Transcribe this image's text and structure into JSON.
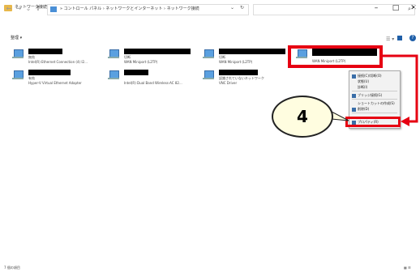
{
  "window": {
    "title": "ネットワーク接続",
    "controls": {
      "minimize": "–",
      "maximize": "□",
      "close": "✕"
    }
  },
  "address_bar": {
    "nav": {
      "back": "←",
      "forward": "→",
      "recent": "⌄",
      "up": "↑"
    },
    "breadcrumb": "» コントロール パネル  ›  ネットワークとインターネット  ›  ネットワーク接続",
    "dropdown": "⌄",
    "refresh": "↻",
    "search_icon": "⌕"
  },
  "toolbar": {
    "organize": "整理 ▾",
    "view_icon": "☰ ▾",
    "help": "?"
  },
  "adapters": [
    {
      "status": "無効",
      "device": "Intel(R) Ethernet Connection (4) I2..."
    },
    {
      "status": "切断",
      "device": "WAN Miniport (L2TP)"
    },
    {
      "status": "切断",
      "device": "WAN Miniport (L2TP)"
    },
    {
      "status": "",
      "device": "WAN Miniport (L2TP)"
    },
    {
      "status": "有効",
      "device": "Hyper-V Virtual Ethernet Adapter"
    },
    {
      "status": "",
      "device": "Intel(R) Dual Band Wireless-AC 82..."
    },
    {
      "status": "認識されていないネットワーク",
      "device": "VNC Driver"
    }
  ],
  "context_menu": [
    "接続(C)/切断(O)",
    "状態(U)",
    "診断(I)",
    "ブリッジ接続(G)",
    "ショートカットの作成(S)",
    "削除(D)",
    "プロパティ(R)"
  ],
  "callout": {
    "number": "4"
  },
  "status_bar": {
    "count": "7 個の項目",
    "right": "▦ ☰"
  },
  "colors": {
    "highlight": "#e60012",
    "callout_fill": "#fffde0",
    "icon_blue": "#5aa0e0"
  }
}
